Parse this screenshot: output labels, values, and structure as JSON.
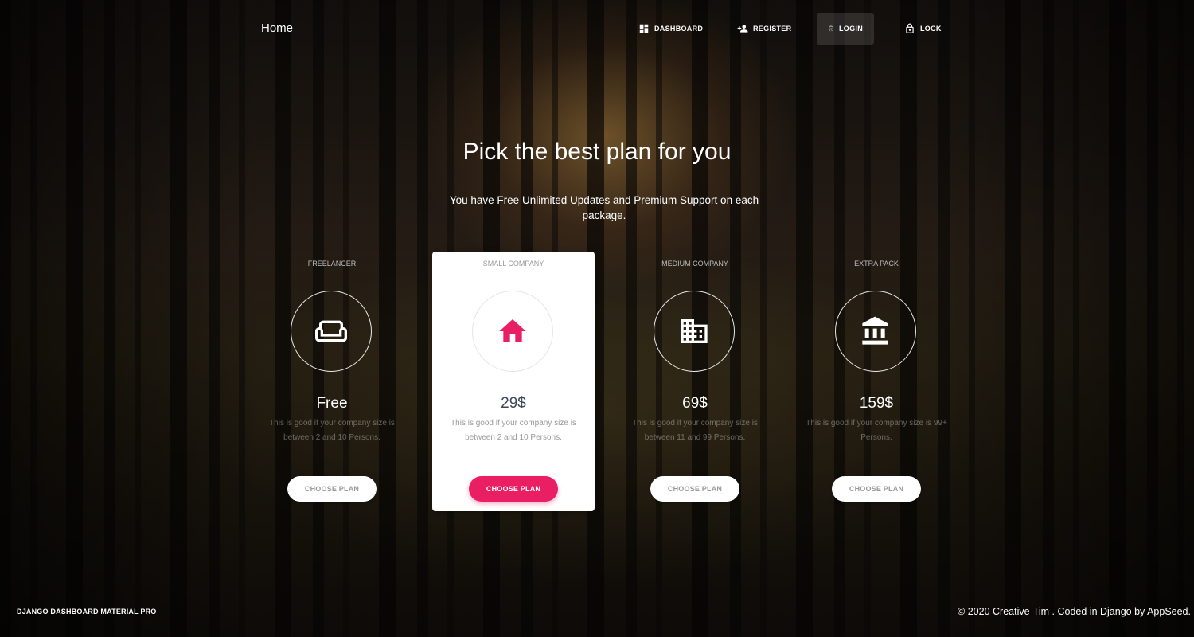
{
  "nav": {
    "brand": "Home",
    "items": [
      {
        "label": "DASHBOARD",
        "icon": "dashboard-icon"
      },
      {
        "label": "REGISTER",
        "icon": "person-add-icon"
      },
      {
        "label": "LOGIN",
        "icon": "fingerprint-icon",
        "active": true
      },
      {
        "label": "LOCK",
        "icon": "lock-icon"
      }
    ]
  },
  "header": {
    "title": "Pick the best plan for you",
    "subtitle": "You have Free Unlimited Updates and Premium Support on each package."
  },
  "plans": [
    {
      "name": "FREELANCER",
      "icon": "sofa-icon",
      "price": "Free",
      "description": "This is good if your company size is between 2 and 10 Persons.",
      "button": "CHOOSE PLAN",
      "featured": false
    },
    {
      "name": "SMALL COMPANY",
      "icon": "home-icon",
      "price": "29$",
      "description": "This is good if your company size is between 2 and 10 Persons.",
      "button": "CHOOSE PLAN",
      "featured": true
    },
    {
      "name": "MEDIUM COMPANY",
      "icon": "business-icon",
      "price": "69$",
      "description": "This is good if your company size is between 11 and 99 Persons.",
      "button": "CHOOSE PLAN",
      "featured": false
    },
    {
      "name": "EXTRA PACK",
      "icon": "bank-icon",
      "price": "159$",
      "description": "This is good if your company size is 99+ Persons.",
      "button": "CHOOSE PLAN",
      "featured": false
    }
  ],
  "footer": {
    "left": "DJANGO DASHBOARD MATERIAL PRO",
    "right": "© 2020 Creative-Tim . Coded in Django by AppSeed."
  },
  "colors": {
    "accent": "#e91e63",
    "card_bg": "#ffffff",
    "price_dark": "#3c4858"
  }
}
